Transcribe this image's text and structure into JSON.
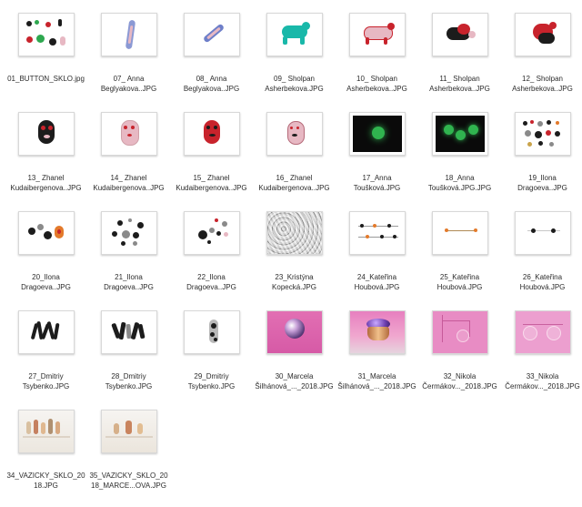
{
  "files": [
    {
      "name": "01_BUTTON_SKLO.jpg"
    },
    {
      "name": "07_ Anna\nBeglyakova..JPG"
    },
    {
      "name": "08_ Anna\nBeglyakova..JPG"
    },
    {
      "name": "09_ Sholpan\nAsherbekova.JPG"
    },
    {
      "name": "10_ Sholpan\nAsherbekova..JPG"
    },
    {
      "name": "11_ Sholpan\nAsherbekova..JPG"
    },
    {
      "name": "12_ Sholpan\nAsherbekova..JPG"
    },
    {
      "name": "13_ Zhanel\nKudaibergenova..JPG"
    },
    {
      "name": "14_ Zhanel\nKudaibergenova..JPG"
    },
    {
      "name": "15_ Zhanel\nKudaibergenova..JPG"
    },
    {
      "name": "16_ Zhanel\nKudaibergenova..JPG"
    },
    {
      "name": "17_Anna\nToušková.JPG"
    },
    {
      "name": "18_Anna\nToušková.JPG.JPG"
    },
    {
      "name": "19_Ilona\nDragoeva..JPG"
    },
    {
      "name": "20_Ilona\nDragoeva..JPG"
    },
    {
      "name": "21_Ilona\nDragoeva..JPG"
    },
    {
      "name": "22_Ilona\nDragoeva..JPG"
    },
    {
      "name": "23_Kristýna\nKopecká.JPG"
    },
    {
      "name": "24_Kateřina\nHoubová.JPG"
    },
    {
      "name": "25_Kateřina\nHoubová.JPG"
    },
    {
      "name": "26_Kateřina\nHoubová.JPG"
    },
    {
      "name": "27_Dmitriy\nTsybenko.JPG"
    },
    {
      "name": "28_Dmitriy\nTsybenko.JPG"
    },
    {
      "name": "29_Dmitriy\nTsybenko.JPG"
    },
    {
      "name": "30_Marcela\nŠilhánová_..._2018.JPG"
    },
    {
      "name": "31_Marcela\nŠilhánová_..._2018.JPG"
    },
    {
      "name": "32_Nikola\nČermákov..._2018.JPG"
    },
    {
      "name": "33_Nikola\nČermákov..._2018.JPG"
    },
    {
      "name": "34_VAZICKY_SKLO_20\n18.JPG"
    },
    {
      "name": "35_VAZICKY_SKLO_20\n18_MARCE...OVA.JPG"
    }
  ]
}
